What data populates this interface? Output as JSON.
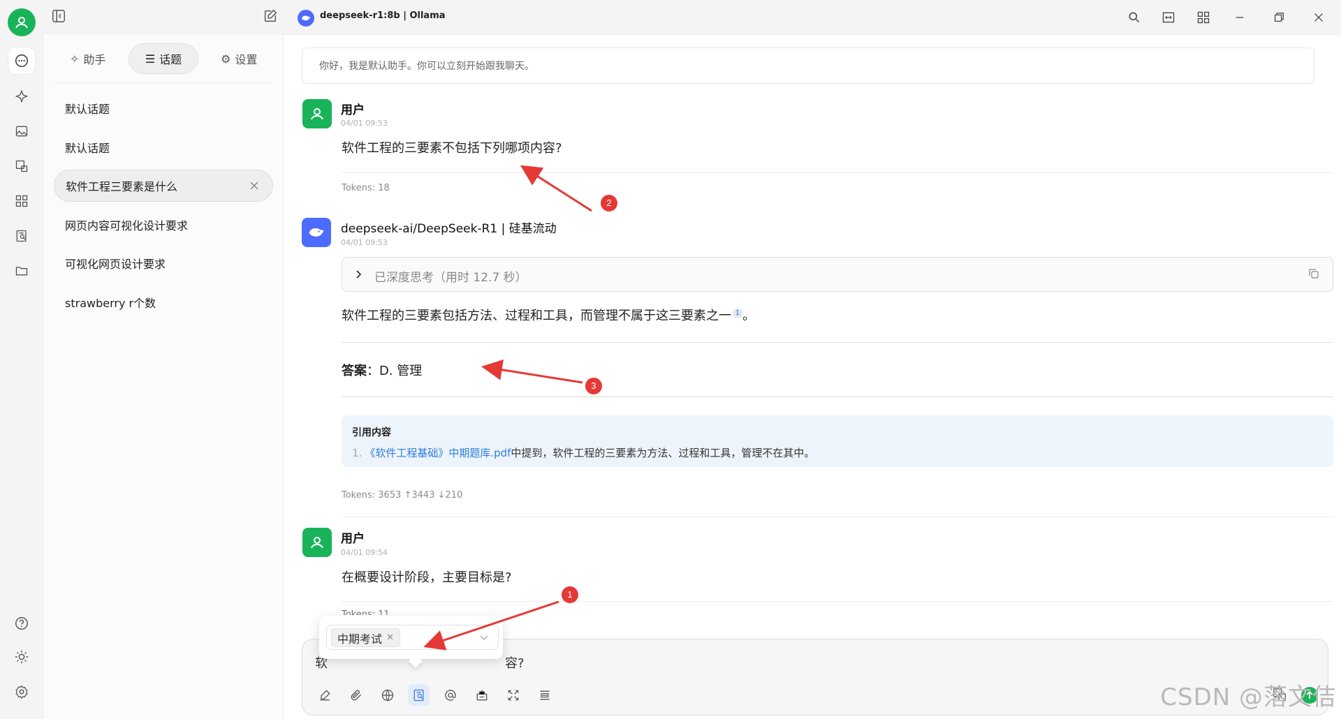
{
  "header": {
    "model_name": "deepseek-r1:8b | Ollama"
  },
  "sidebar": {
    "tabs": [
      {
        "label": "助手"
      },
      {
        "label": "话题"
      },
      {
        "label": "设置"
      }
    ],
    "topics": [
      {
        "label": "默认话题"
      },
      {
        "label": "默认话题"
      },
      {
        "label": "软件工程三要素是什么"
      },
      {
        "label": "网页内容可视化设计要求"
      },
      {
        "label": "可视化网页设计要求"
      },
      {
        "label": "strawberry r个数"
      }
    ]
  },
  "chat": {
    "welcome": "你好，我是默认助手。你可以立刻开始跟我聊天。",
    "messages": [
      {
        "sender": "用户",
        "time": "04/01 09:53",
        "text": "软件工程的三要素不包括下列哪项内容?",
        "tokens": "Tokens: 18"
      },
      {
        "sender": "deepseek-ai/DeepSeek-R1 | 硅基流动",
        "time": "04/01 09:53",
        "thinking": "已深度思考（用时 12.7 秒）",
        "text": "软件工程的三要素包括方法、过程和工具，而管理不属于这三要素之一",
        "footnote": "1",
        "text_end": "。",
        "answer_label": "答案",
        "answer_value": "D. 管理",
        "citation_title": "引用内容",
        "citation_num": "1.",
        "citation_link": "《软件工程基础》中期题库.pdf",
        "citation_text": "中提到，软件工程的三要素为方法、过程和工具，管理不在其中。",
        "tokens": "Tokens: 3653 ↑3443 ↓210"
      },
      {
        "sender": "用户",
        "time": "04/01 09:54",
        "text": "在概要设计阶段，主要目标是?",
        "tokens": "Tokens: 11"
      }
    ]
  },
  "input": {
    "value_start": "软",
    "value_end": "容?",
    "knowledge_tag": "中期考试"
  },
  "annotations": [
    "1",
    "2",
    "3"
  ],
  "watermark": "CSDN @落文佶",
  "colors": {
    "accent_green": "#19b35a",
    "deepseek_blue": "#4d6bfe",
    "link_blue": "#2d7fe0",
    "annotation_red": "#e53935"
  }
}
